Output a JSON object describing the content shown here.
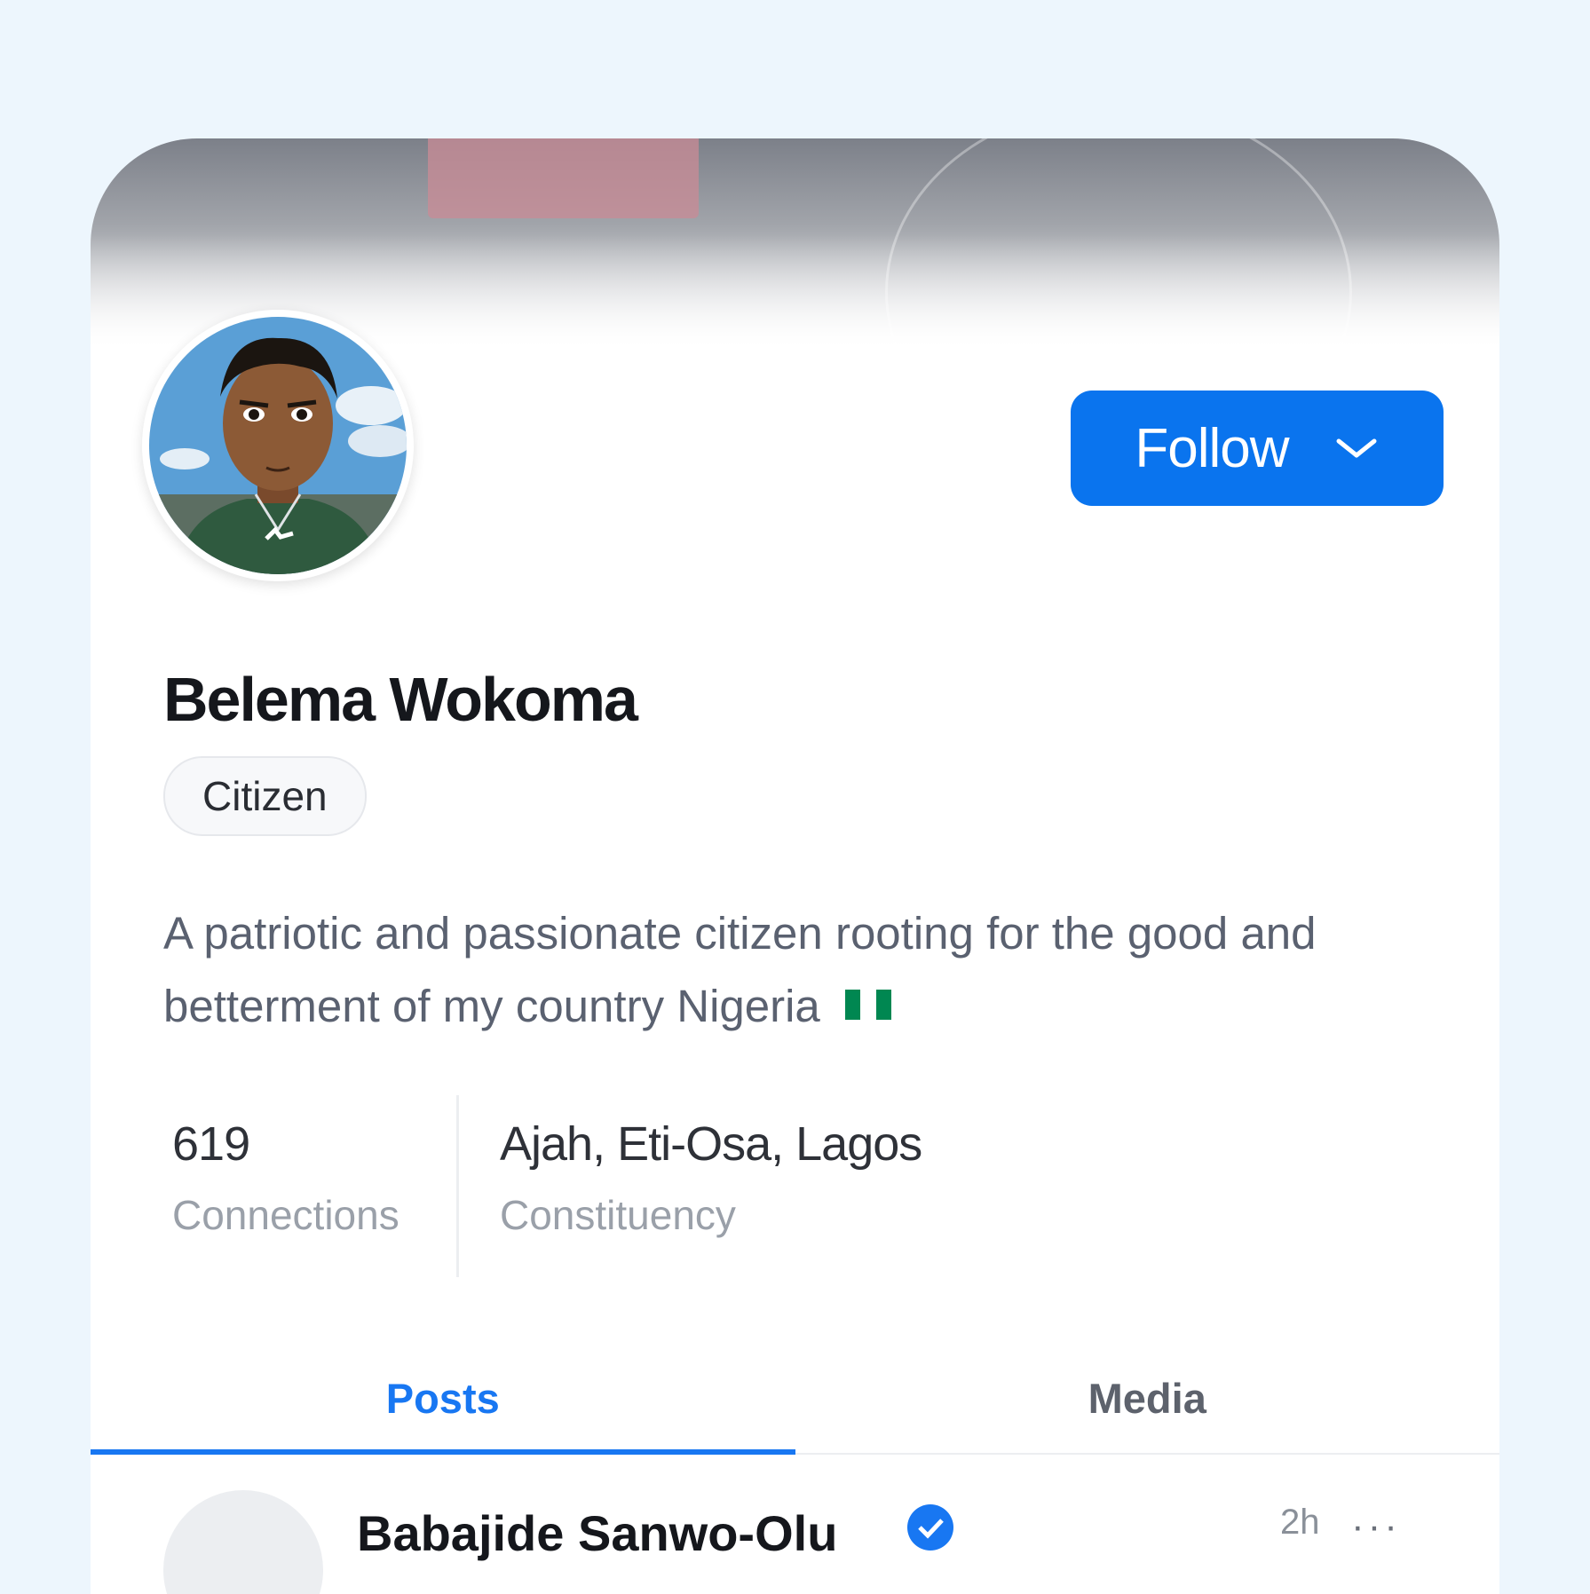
{
  "profile": {
    "name": "Belema Wokoma",
    "role_badge": "Citizen",
    "bio": "A patriotic and passionate citizen rooting for the good and betterment of my country Nigeria",
    "follow_label": "Follow"
  },
  "stats": {
    "connections_value": "619",
    "connections_label": "Connections",
    "constituency_value": "Ajah, Eti-Osa, Lagos",
    "constituency_label": "Constituency"
  },
  "tabs": [
    {
      "label": "Posts",
      "active": true
    },
    {
      "label": "Media",
      "active": false
    }
  ],
  "post_preview": {
    "author_partial": "Babajide Sanwo-Olu",
    "time_partial": "2h",
    "more_label": "···"
  },
  "colors": {
    "accent": "#0a74ee",
    "page_background": "#edf6fd",
    "tab_active": "#1877f2",
    "flag_green": "#008751"
  },
  "icons": {
    "follow_dropdown": "chevron-down-icon",
    "flag": "nigeria-flag-icon",
    "verified": "verified-badge-icon"
  }
}
